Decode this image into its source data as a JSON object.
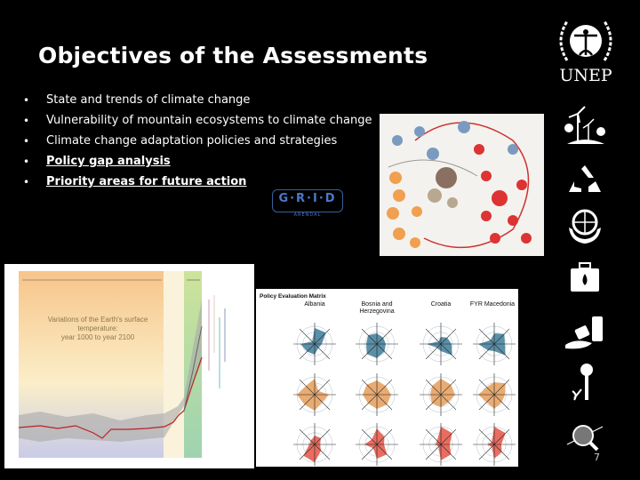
{
  "slide": {
    "title": "Objectives of the Assessments",
    "bullets": [
      {
        "text": "State and trends of climate change",
        "underlined": false
      },
      {
        "text": "Vulnerability of mountain ecosystems to climate change",
        "underlined": false
      },
      {
        "text": "Climate change adaptation policies and strategies",
        "underlined": false
      },
      {
        "text": "Policy gap analysis",
        "underlined": true
      },
      {
        "text": "Priority areas for future action",
        "underlined": true
      }
    ],
    "page_number": "7"
  },
  "grid_logo": {
    "letters": "G·R·I·D",
    "sub": "ARENDAL"
  },
  "unep_logo": {
    "text": "UNEP"
  },
  "temperature_figure": {
    "caption_line1": "Variations of the Earth's surface temperature:",
    "caption_line2": "year 1000 to year 2100"
  },
  "policy_matrix": {
    "title": "Policy Evaluation Matrix",
    "columns": [
      "Albania",
      "Bosnia and Herzegovina",
      "Croatia",
      "FYR Macedonia"
    ],
    "row_colors": [
      "#5b8fa8",
      "#e8ab72",
      "#e86d60"
    ]
  },
  "side_icons": [
    "wind-turbine-icon",
    "recycle-icon",
    "globe-hands-icon",
    "briefcase-drop-icon",
    "spill-barrel-icon",
    "tree-industry-icon",
    "magnifier-globe-icon"
  ]
}
